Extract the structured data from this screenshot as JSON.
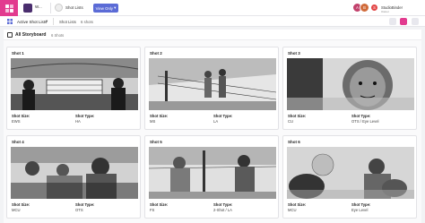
{
  "topbar": {
    "project_name": "W...",
    "shot_lists_label": "Shot Lists",
    "view_only_label": "View Only",
    "user_name": "StudioBinder",
    "user_sub": "Owner",
    "avatars": [
      "A",
      "B",
      "S"
    ]
  },
  "subbar": {
    "active_label": "Active Shot Lists",
    "chevron": "▾",
    "shot_lists_label": "Shot Lists",
    "shot_count": "6 shots"
  },
  "storyboard": {
    "title": "All Storyboard",
    "count": "6 Shots",
    "cards": [
      {
        "title": "Shot 1",
        "size_label": "Shot Size:",
        "size": "EWS",
        "type_label": "Shot Type:",
        "type": "HA"
      },
      {
        "title": "Shot 2",
        "size_label": "Shot Size:",
        "size": "MS",
        "type_label": "Shot Type:",
        "type": "LA"
      },
      {
        "title": "Shot 3",
        "size_label": "Shot Size:",
        "size": "CU",
        "type_label": "Shot Type:",
        "type": "OTS / Eye Level"
      },
      {
        "title": "Shot 4",
        "size_label": "Shot Size:",
        "size": "MCU",
        "type_label": "Shot Type:",
        "type": "OTS"
      },
      {
        "title": "Shot 5",
        "size_label": "Shot Size:",
        "size": "FS",
        "type_label": "Shot Type:",
        "type": "2-Shot / LA"
      },
      {
        "title": "Shot 6",
        "size_label": "Shot Size:",
        "size": "MCU",
        "type_label": "Shot Type:",
        "type": "Eye Level"
      }
    ]
  },
  "colors": {
    "brand": "#e23b8f",
    "view_only": "#5b6bd6"
  }
}
